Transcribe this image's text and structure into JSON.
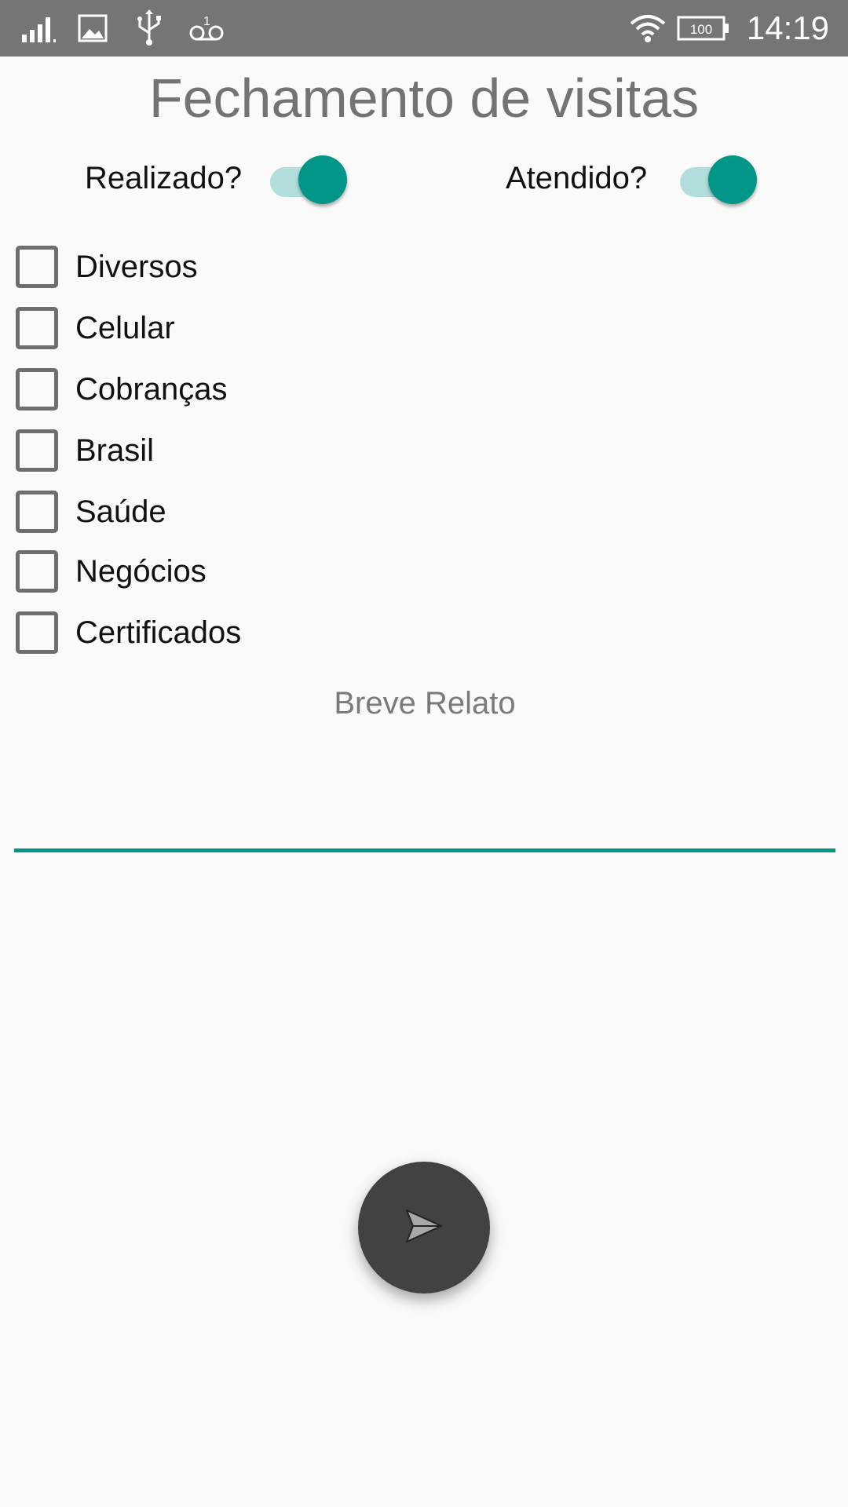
{
  "status_bar": {
    "time": "14:19",
    "battery_level": "100",
    "icons": [
      "signal-icon",
      "image-icon",
      "usb-icon",
      "voicemail-icon",
      "wifi-icon",
      "battery-icon"
    ]
  },
  "page": {
    "title": "Fechamento de visitas"
  },
  "switches": [
    {
      "label": "Realizado?",
      "checked": true
    },
    {
      "label": "Atendido?",
      "checked": true
    }
  ],
  "checkboxes": [
    {
      "label": "Diversos",
      "checked": false
    },
    {
      "label": "Celular",
      "checked": false
    },
    {
      "label": "Cobranças",
      "checked": false
    },
    {
      "label": "Brasil",
      "checked": false
    },
    {
      "label": "Saúde",
      "checked": false
    },
    {
      "label": "Negócios",
      "checked": false
    },
    {
      "label": "Certificados",
      "checked": false
    }
  ],
  "relato": {
    "placeholder": "Breve Relato",
    "value": ""
  },
  "fab": {
    "icon": "send-icon"
  },
  "colors": {
    "accent": "#009688",
    "accent_light": "#b2dfdb",
    "status_bar": "#757575",
    "fab": "#424242",
    "background": "#fafafa"
  }
}
